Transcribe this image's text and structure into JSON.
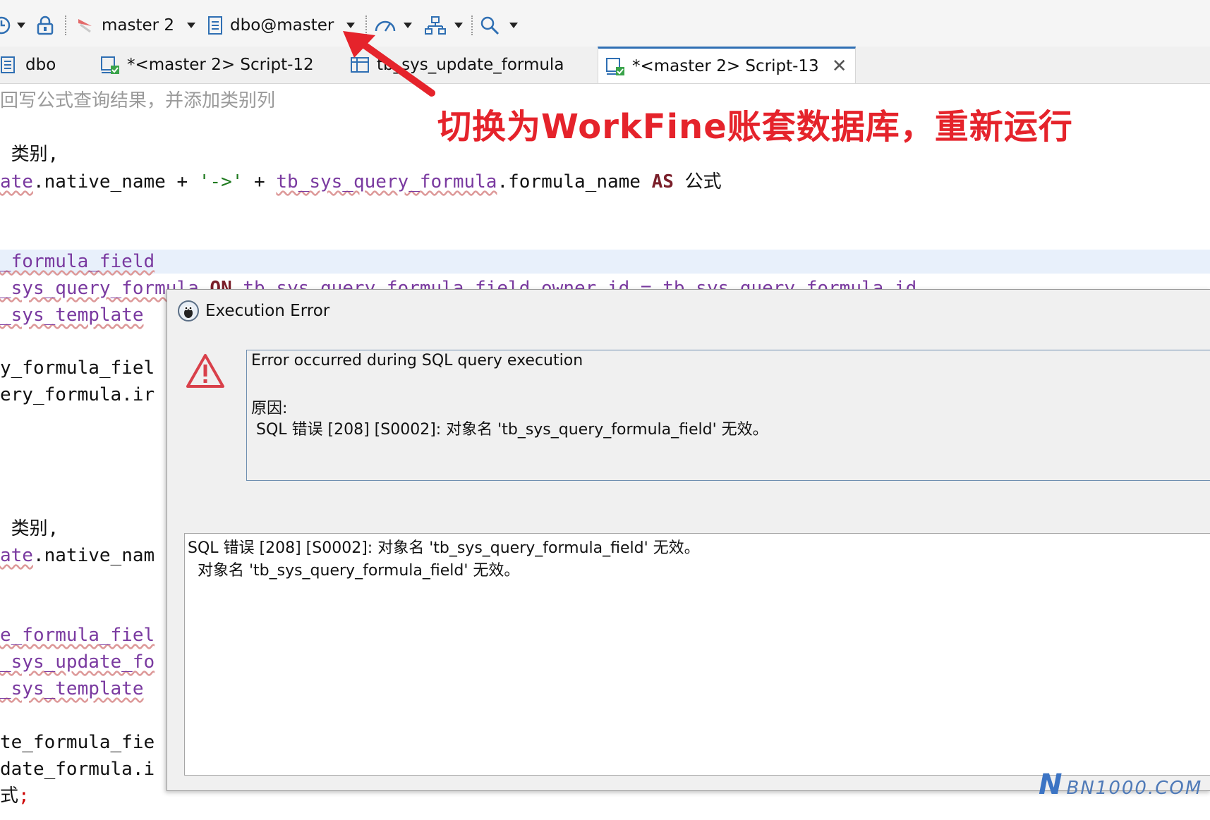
{
  "toolbar": {
    "connection_label": "master 2",
    "database_label": "dbo@master"
  },
  "tabs": [
    {
      "label": "dbo"
    },
    {
      "label": "*<master 2> Script-12"
    },
    {
      "label": "tb_sys_update_formula"
    },
    {
      "label": "*<master 2> Script-13"
    }
  ],
  "editor": {
    "comment": "回写公式查询结果，并添加类别列",
    "lines": {
      "l1": " 类别,",
      "l2a": "ate",
      "l2b": ".native_name + ",
      "l2c": "'->'",
      "l2d": " + ",
      "l2e": "tb_sys_query_formula",
      "l2f": ".formula_name ",
      "l2g": "AS",
      "l2h": " 公式",
      "l3": "_formula_field",
      "l4a": "_sys_query_formula ",
      "l4b": "ON",
      "l4c": " tb_sys_query_formula_field.owner_id = tb_sys_query_formula.id",
      "l5": "_sys_template",
      "l6": "y_formula_fiel",
      "l7": "ery_formula.ir",
      "l8": " 类别,",
      "l9a": "ate",
      "l9b": ".native_nam",
      "l10": "e_formula_fiel",
      "l11": "_sys_update_fo",
      "l12": "_sys_template",
      "l13": "te_formula_fie",
      "l14": "date_formula.i",
      "l15a": "式",
      "l15b": ";"
    }
  },
  "annotation": {
    "text": "切换为WorkFine账套数据库，重新运行",
    "color": "#e5232b"
  },
  "dialog": {
    "title": "Execution Error",
    "message_heading": "Error occurred during SQL query execution",
    "reason_label": "原因:",
    "reason_text": " SQL 错误 [208] [S0002]: 对象名 'tb_sys_query_formula_field' 无效。",
    "detail_line1": "SQL 错误 [208] [S0002]: 对象名 'tb_sys_query_formula_field' 无效。",
    "detail_line2": "  对象名 'tb_sys_query_formula_field' 无效。"
  },
  "watermark": {
    "letter": "N",
    "text": "BN1000.COM"
  },
  "colors": {
    "accent": "#2f6fb3",
    "annotation": "#e5232b",
    "keyword": "#7a1f2a",
    "string": "#1f7a1f"
  }
}
